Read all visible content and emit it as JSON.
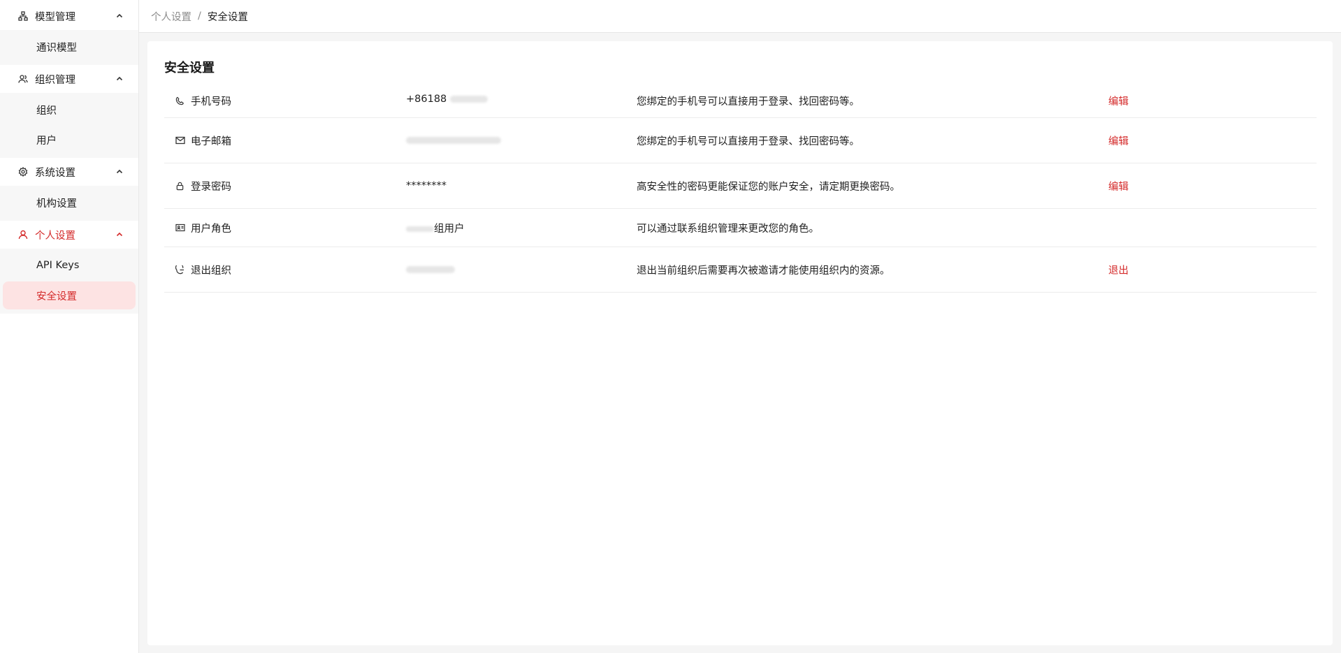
{
  "sidebar": {
    "groups": [
      {
        "label": "模型管理",
        "items": [
          {
            "label": "通识模型"
          }
        ]
      },
      {
        "label": "组织管理",
        "items": [
          {
            "label": "组织"
          },
          {
            "label": "用户"
          }
        ]
      },
      {
        "label": "系统设置",
        "items": [
          {
            "label": "机构设置"
          }
        ]
      },
      {
        "label": "个人设置",
        "active": true,
        "items": [
          {
            "label": "API Keys"
          },
          {
            "label": "安全设置",
            "active": true
          }
        ]
      }
    ]
  },
  "breadcrumb": {
    "parent": "个人设置",
    "separator": "/",
    "current": "安全设置"
  },
  "card": {
    "title": "安全设置",
    "rows": [
      {
        "icon": "phone-icon",
        "label": "手机号码",
        "value": "+86188",
        "description": "您绑定的手机号可以直接用于登录、找回密码等。",
        "action": "编辑"
      },
      {
        "icon": "mail-icon",
        "label": "电子邮箱",
        "value": "",
        "description": "您绑定的手机号可以直接用于登录、找回密码等。",
        "action": "编辑"
      },
      {
        "icon": "lock-icon",
        "label": "登录密码",
        "value": "********",
        "description": "高安全性的密码更能保证您的账户安全，请定期更换密码。",
        "action": "编辑"
      },
      {
        "icon": "id-card-icon",
        "label": "用户角色",
        "value": "组用户",
        "description": "可以通过联系组织管理来更改您的角色。",
        "action": ""
      },
      {
        "icon": "logout-icon",
        "label": "退出组织",
        "value": "",
        "description": "退出当前组织后需要再次被邀请才能使用组织内的资源。",
        "action": "退出"
      }
    ]
  },
  "colors": {
    "accent": "#d42a2a",
    "active_bg": "#fde3e3",
    "submenu_bg": "#f7f7f7"
  }
}
